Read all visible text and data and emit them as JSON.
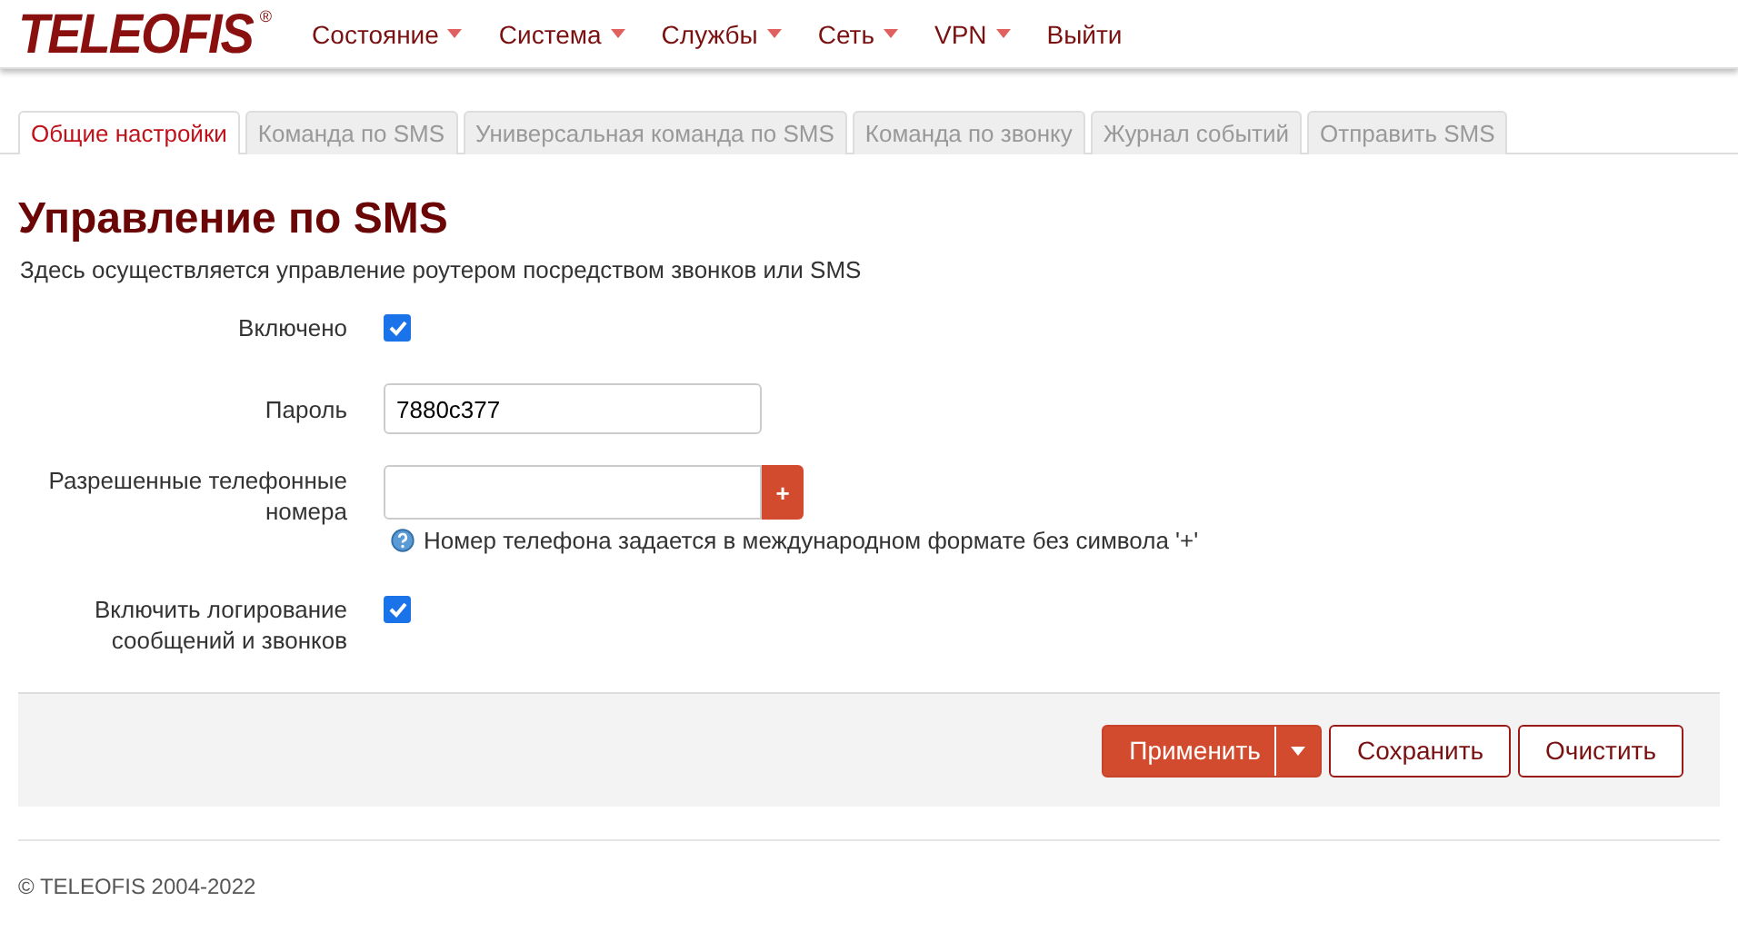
{
  "header": {
    "logo": "TELEOFIS",
    "logo_mark": "®",
    "menu": [
      {
        "label": "Состояние",
        "dropdown": true
      },
      {
        "label": "Система",
        "dropdown": true
      },
      {
        "label": "Службы",
        "dropdown": true
      },
      {
        "label": "Сеть",
        "dropdown": true
      },
      {
        "label": "VPN",
        "dropdown": true
      },
      {
        "label": "Выйти",
        "dropdown": false
      }
    ]
  },
  "tabs": [
    {
      "label": "Общие настройки",
      "selected": true
    },
    {
      "label": "Команда по SMS",
      "selected": false
    },
    {
      "label": "Универсальная команда по SMS",
      "selected": false
    },
    {
      "label": "Команда по звонку",
      "selected": false
    },
    {
      "label": "Журнал событий",
      "selected": false
    },
    {
      "label": "Отправить SMS",
      "selected": false
    }
  ],
  "page": {
    "title": "Управление по SMS",
    "description": "Здесь осуществляется управление роутером посредством звонков или SMS"
  },
  "fields": [
    {
      "kind": "checkbox",
      "label": "Включено",
      "checked": true
    },
    {
      "kind": "text",
      "label": "Пароль",
      "value": "7880c377"
    },
    {
      "kind": "list",
      "label": "Разрешенные телефонные номера",
      "add": "+",
      "hint": "Номер телефона задается в международном формате без символа '+'"
    },
    {
      "kind": "checkbox",
      "label": "Включить логирование сообщений и звонков",
      "checked": true
    }
  ],
  "actions": [
    {
      "kind": "primary",
      "label": "Применить",
      "dropdown": true
    },
    {
      "kind": "outline",
      "label": "Сохранить"
    },
    {
      "kind": "outline",
      "label": "Очистить"
    }
  ],
  "footer": "© TELEOFIS 2004-2022"
}
